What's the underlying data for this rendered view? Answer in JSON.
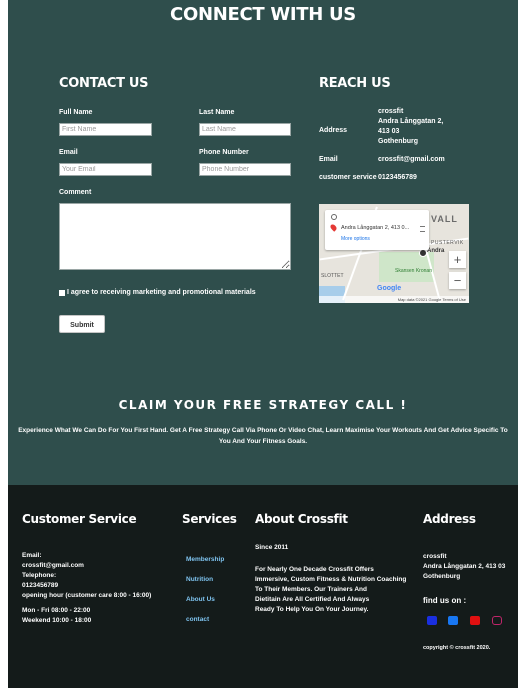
{
  "contact_section": {
    "title": "CONNECT WITH US",
    "contact_heading": "CONTACT US",
    "form": {
      "first_name_label": "Full Name",
      "first_name_placeholder": "First Name",
      "last_name_label": "Last Name",
      "last_name_placeholder": "Last Name",
      "email_label": "Email",
      "email_placeholder": "Your Email",
      "phone_label": "Phone Number",
      "phone_placeholder": "Phone Number",
      "comment_label": "Comment",
      "agree_label": "I agree to receiving marketing and promotional materials",
      "submit_label": "Submit"
    },
    "reach_heading": "REACH US",
    "reach": {
      "address_label": "Address",
      "address_lines": [
        "crossfit",
        "Andra Långgatan 2,",
        "413 03",
        "Gothenburg"
      ],
      "email_label": "Email",
      "email_value": "crossfit@gmail.com",
      "customer_service_label": "customer service",
      "customer_service_value": "0123456789"
    },
    "map": {
      "address_text": "Andra Långgatan 2, 413 0...",
      "more_options": "More options",
      "label_valla": "VALL",
      "label_pustervik": "PUSTERVIK",
      "label_andra": "Andra",
      "label_skansen": "Skansen Kronan",
      "label_slottet": "SLOTTET",
      "google": "Google",
      "credit": "Map data ©2021 Google   Terms of Use",
      "zoom_in": "+",
      "zoom_out": "−"
    },
    "claim_title": "CLAIM YOUR FREE STRATEGY CALL !",
    "claim_body": "Experience What We Can Do For You First Hand. Get A Free Strategy Call Via Phone Or Video Chat, Learn Maximise Your Workouts And Get Advice Specific To You And Your Fitness Goals."
  },
  "footer": {
    "customer_service": {
      "title": "Customer Service",
      "email_label": "Email:",
      "email_value": "crossfit@gmail.com",
      "telephone_label": "Telephone:",
      "telephone_value": "0123456789",
      "hours_label": "opening hour (customer care 8:00 - 16:00)",
      "weekdays": "Mon - Fri 08:00 - 22:00",
      "weekend": "Weekend 10:00 - 18:00"
    },
    "services": {
      "title": "Services",
      "items": [
        "Membership",
        "Nutrition",
        "About Us",
        "contact"
      ]
    },
    "about": {
      "title": "About Crossfit",
      "since": "Since 2011",
      "text_lines": [
        "For Nearly One Decade Crossfit Offers",
        "Immersive, Custom Fitness & Nutrition Coaching",
        "To Their Members. Our Trainers And",
        "Dietitain Are All Certified And Always",
        "Ready To Help You On Your Journey."
      ]
    },
    "address": {
      "title": "Address",
      "lines": [
        "crossfit",
        "Andra Långgatan 2, 413 03",
        "Gothenburg"
      ],
      "find_us": "find us on :",
      "copyright": "copyright © crossfit 2020."
    },
    "social_colors": [
      "#1a2fe0",
      "#1877f2",
      "#e01010",
      "#c0256a"
    ]
  }
}
